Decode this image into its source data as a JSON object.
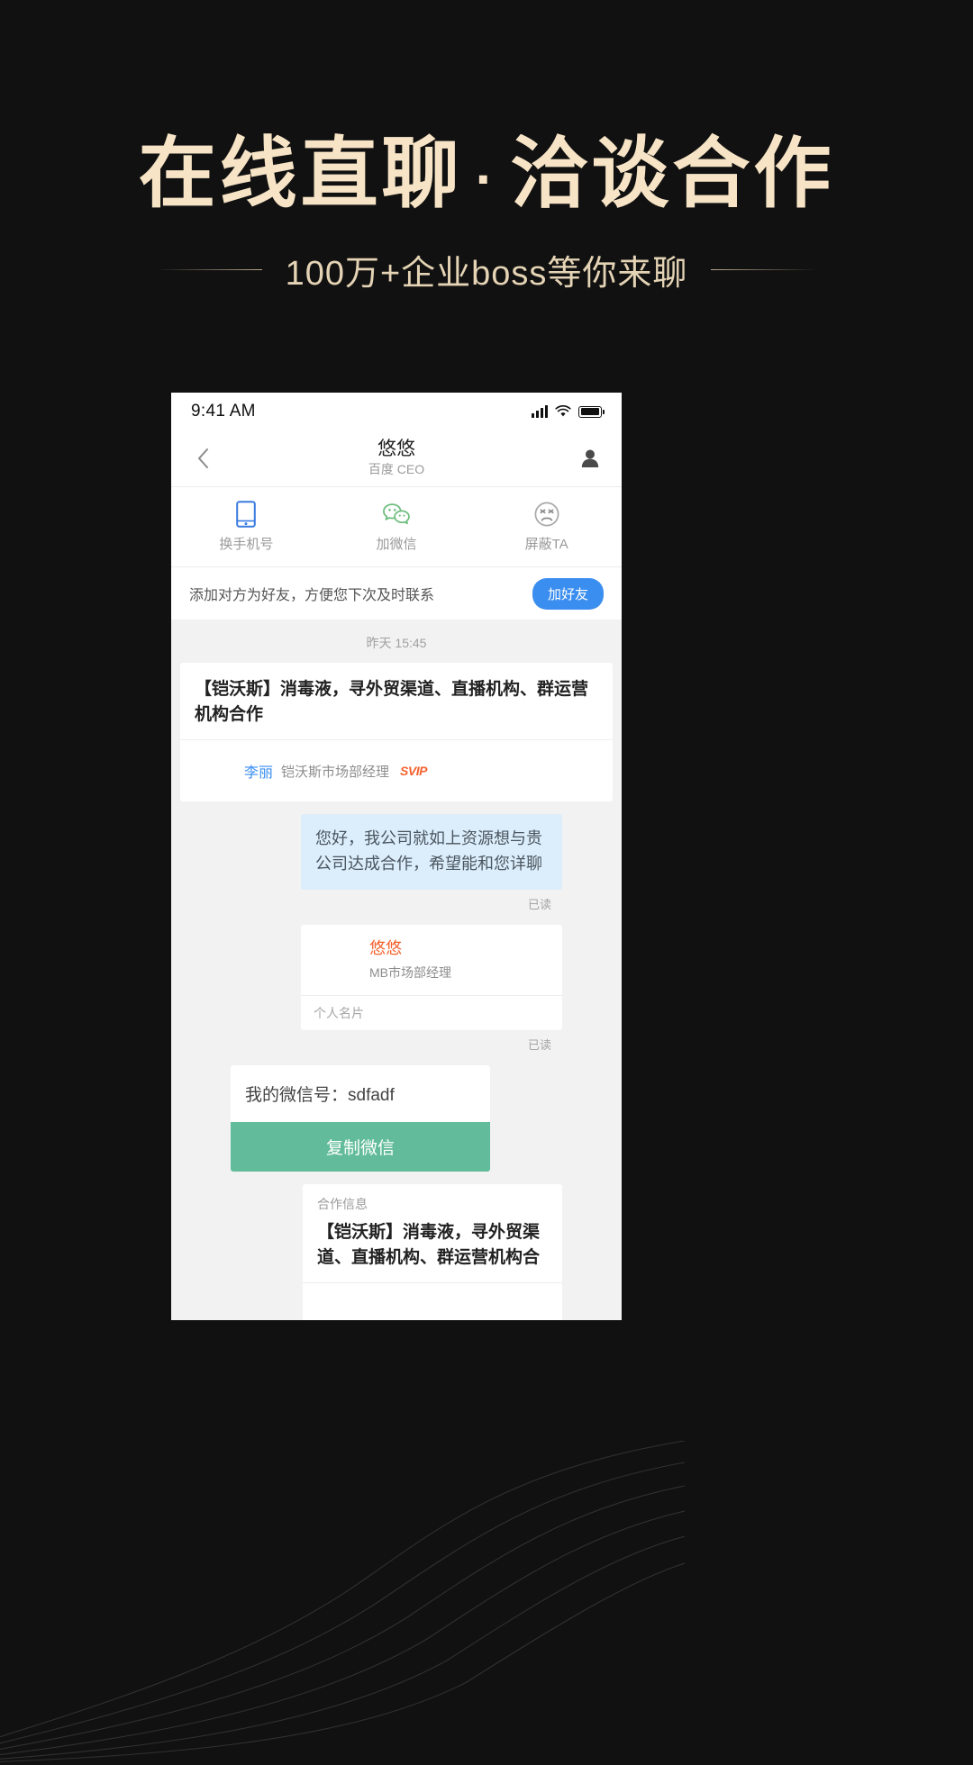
{
  "banner": {
    "headline_left": "在线直聊",
    "headline_dot": "·",
    "headline_right": "洽谈合作",
    "subtitle": "100万+企业boss等你来聊",
    "headline_color": "#F7E4C6",
    "subtitle_color": "#E4D3B4",
    "background_color": "#111111"
  },
  "phone": {
    "statusbar": {
      "time": "9:41 AM"
    },
    "navbar": {
      "back_icon": "chevron-left-icon",
      "title": "悠悠",
      "subtitle": "百度 CEO",
      "person_icon": "person-icon"
    },
    "actions": [
      {
        "icon": "phone-icon",
        "label": "换手机号",
        "color": "#3A7BE0"
      },
      {
        "icon": "wechat-icon",
        "label": "加微信",
        "color": "#6FBE7F"
      },
      {
        "icon": "block-face-icon",
        "label": "屏蔽TA",
        "color": "#9a9a9a"
      }
    ],
    "friend_bar": {
      "text": "添加对方为好友，方便您下次及时联系",
      "button_label": "加好友",
      "button_color": "#3A8EF0"
    },
    "thread": {
      "timestamp": "昨天 15:45",
      "job_card": {
        "title": "【铠沃斯】消毒液，寻外贸渠道、直播机构、群运营机构合作",
        "author_name": "李丽",
        "author_role": "铠沃斯市场部经理",
        "badge": "SVIP",
        "badge_color": "#F4622E",
        "name_color": "#3A8EF0"
      },
      "message_blue": {
        "text": "您好，我公司就如上资源想与贵公司达成合作，希望能和您详聊",
        "read_status": "已读",
        "bubble_color": "#DCEEFB"
      },
      "name_card": {
        "name": "悠悠",
        "role": "MB市场部经理",
        "footer": "个人名片",
        "read_status": "已读",
        "name_color": "#F4622E"
      },
      "wechat_card": {
        "label": "我的微信号：",
        "value": "sdfadf",
        "button_label": "复制微信",
        "button_color": "#62BC9B"
      },
      "coop_card": {
        "tag": "合作信息",
        "title": "【铠沃斯】消毒液，寻外贸渠道、直播机构、群运营机构合"
      }
    }
  }
}
